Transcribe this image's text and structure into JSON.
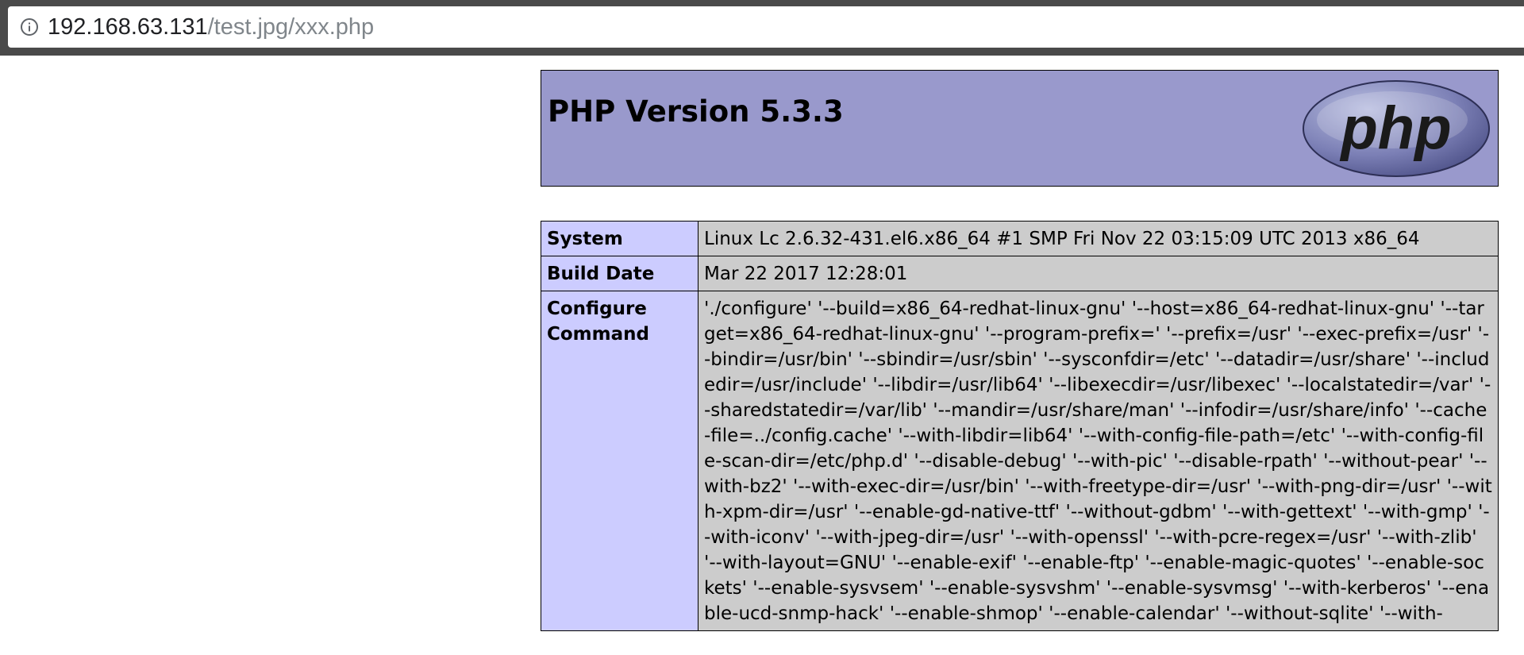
{
  "browser": {
    "url_host": "192.168.63.131",
    "url_path": "/test.jpg/xxx.php",
    "info_icon": "info-circle-icon"
  },
  "header": {
    "title": "PHP Version 5.3.3",
    "logo_text": "php",
    "logo_icon": "php-logo-icon",
    "bg_color": "#9999cc"
  },
  "table": {
    "rows": [
      {
        "key": "System",
        "value": "Linux Lc 2.6.32-431.el6.x86_64 #1 SMP Fri Nov 22 03:15:09 UTC 2013 x86_64"
      },
      {
        "key": "Build Date",
        "value": "Mar 22 2017 12:28:01"
      },
      {
        "key": "Configure Command",
        "value": "'./configure' '--build=x86_64-redhat-linux-gnu' '--host=x86_64-redhat-linux-gnu' '--target=x86_64-redhat-linux-gnu' '--program-prefix=' '--prefix=/usr' '--exec-prefix=/usr' '--bindir=/usr/bin' '--sbindir=/usr/sbin' '--sysconfdir=/etc' '--datadir=/usr/share' '--includedir=/usr/include' '--libdir=/usr/lib64' '--libexecdir=/usr/libexec' '--localstatedir=/var' '--sharedstatedir=/var/lib' '--mandir=/usr/share/man' '--infodir=/usr/share/info' '--cache-file=../config.cache' '--with-libdir=lib64' '--with-config-file-path=/etc' '--with-config-file-scan-dir=/etc/php.d' '--disable-debug' '--with-pic' '--disable-rpath' '--without-pear' '--with-bz2' '--with-exec-dir=/usr/bin' '--with-freetype-dir=/usr' '--with-png-dir=/usr' '--with-xpm-dir=/usr' '--enable-gd-native-ttf' '--without-gdbm' '--with-gettext' '--with-gmp' '--with-iconv' '--with-jpeg-dir=/usr' '--with-openssl' '--with-pcre-regex=/usr' '--with-zlib' '--with-layout=GNU' '--enable-exif' '--enable-ftp' '--enable-magic-quotes' '--enable-sockets' '--enable-sysvsem' '--enable-sysvshm' '--enable-sysvmsg' '--with-kerberos' '--enable-ucd-snmp-hack' '--enable-shmop' '--enable-calendar' '--without-sqlite' '--with-"
      }
    ],
    "key_color": "#ccccff",
    "value_color": "#cccccc"
  }
}
